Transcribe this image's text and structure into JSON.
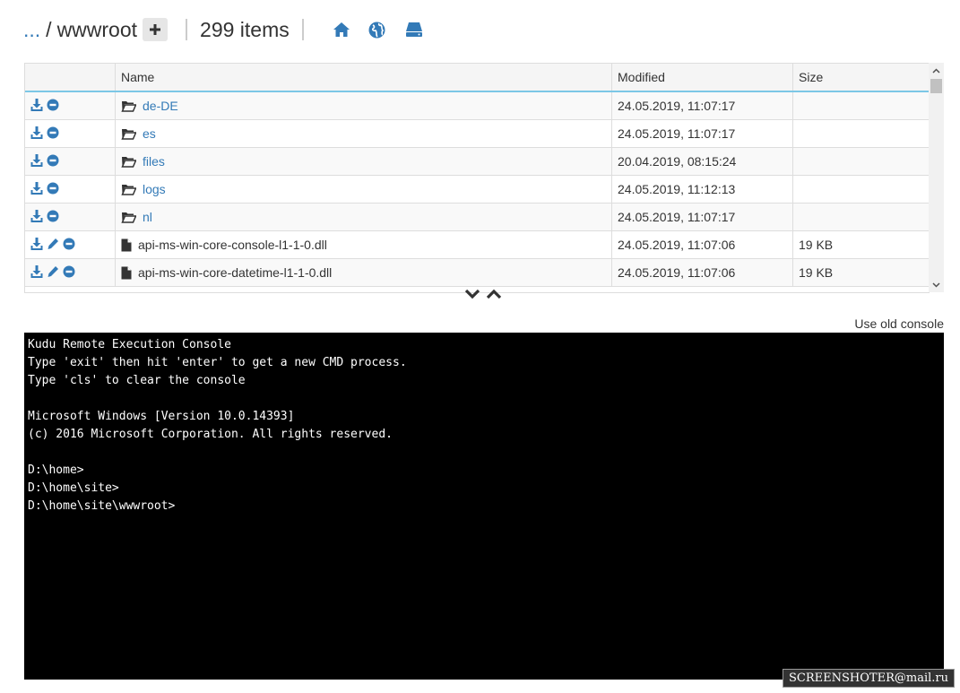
{
  "header": {
    "ellipsis": "...",
    "separator": "/",
    "folder": "wwwroot",
    "item_count": "299 items",
    "icons": [
      "plus-icon",
      "home-icon",
      "globe-icon",
      "drive-icon"
    ]
  },
  "table": {
    "columns": [
      "Name",
      "Modified",
      "Size"
    ],
    "rows": [
      {
        "type": "folder",
        "name": "de-DE",
        "modified": "24.05.2019, 11:07:17",
        "size": ""
      },
      {
        "type": "folder",
        "name": "es",
        "modified": "24.05.2019, 11:07:17",
        "size": ""
      },
      {
        "type": "folder",
        "name": "files",
        "modified": "20.04.2019, 08:15:24",
        "size": ""
      },
      {
        "type": "folder",
        "name": "logs",
        "modified": "24.05.2019, 11:12:13",
        "size": ""
      },
      {
        "type": "folder",
        "name": "nl",
        "modified": "24.05.2019, 11:07:17",
        "size": ""
      },
      {
        "type": "file",
        "name": "api-ms-win-core-console-l1-1-0.dll",
        "modified": "24.05.2019, 11:07:06",
        "size": "19 KB"
      },
      {
        "type": "file",
        "name": "api-ms-win-core-datetime-l1-1-0.dll",
        "modified": "24.05.2019, 11:07:06",
        "size": "19 KB"
      }
    ]
  },
  "old_console_link": "Use old console",
  "console": {
    "lines": [
      "Kudu Remote Execution Console",
      "Type 'exit' then hit 'enter' to get a new CMD process.",
      "Type 'cls' to clear the console",
      "",
      "Microsoft Windows [Version 10.0.14393]",
      "(c) 2016 Microsoft Corporation. All rights reserved.",
      "",
      "D:\\home>",
      "D:\\home\\site>",
      "D:\\home\\site\\wwwroot>"
    ]
  },
  "watermark": "SCREENSHOTER@mail.ru",
  "colors": {
    "link": "#337ab7",
    "header_underline": "#7cc7e6",
    "console_bg": "#000000"
  }
}
